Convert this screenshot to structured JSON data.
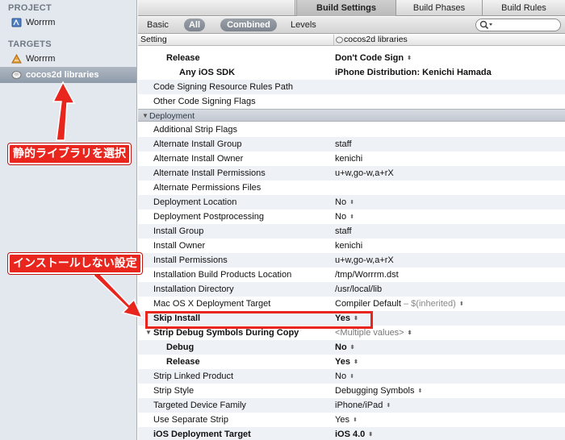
{
  "navigator": {
    "project_header": "PROJECT",
    "project_item": "Worrrm",
    "targets_header": "TARGETS",
    "targets": [
      {
        "label": "Worrrm",
        "selected": false
      },
      {
        "label": "cocos2d libraries",
        "selected": true
      }
    ]
  },
  "tabs": [
    "Build Settings",
    "Build Phases",
    "Build Rules"
  ],
  "active_tab": "Build Settings",
  "filters": {
    "basic": "Basic",
    "all": "All",
    "combined": "Combined",
    "levels": "Levels",
    "search_placeholder": ""
  },
  "columns": {
    "setting": "Setting",
    "target": "cocos2d libraries"
  },
  "rows": {
    "r0": {
      "name": "Release",
      "value": "Don't Code Sign"
    },
    "r1": {
      "name": "Any iOS SDK",
      "value": "iPhone Distribution: Kenichi Hamada"
    },
    "r2": {
      "name": "Code Signing Resource Rules Path",
      "value": ""
    },
    "r3": {
      "name": "Other Code Signing Flags",
      "value": ""
    },
    "section_deployment": "Deployment",
    "r4": {
      "name": "Additional Strip Flags",
      "value": ""
    },
    "r5": {
      "name": "Alternate Install Group",
      "value": "staff"
    },
    "r6": {
      "name": "Alternate Install Owner",
      "value": "kenichi"
    },
    "r7": {
      "name": "Alternate Install Permissions",
      "value": "u+w,go-w,a+rX"
    },
    "r8": {
      "name": "Alternate Permissions Files",
      "value": ""
    },
    "r9": {
      "name": "Deployment Location",
      "value": "No"
    },
    "r10": {
      "name": "Deployment Postprocessing",
      "value": "No"
    },
    "r11": {
      "name": "Install Group",
      "value": "staff"
    },
    "r12": {
      "name": "Install Owner",
      "value": "kenichi"
    },
    "r13": {
      "name": "Install Permissions",
      "value": "u+w,go-w,a+rX"
    },
    "r14": {
      "name": "Installation Build Products Location",
      "value": "/tmp/Worrrm.dst"
    },
    "r15": {
      "name": "Installation Directory",
      "value": "/usr/local/lib"
    },
    "r16": {
      "name": "Mac OS X Deployment Target",
      "value": "Compiler Default",
      "inherited": "–  $(inherited)"
    },
    "r17": {
      "name": "Skip Install",
      "value": "Yes"
    },
    "r18": {
      "name": "Strip Debug Symbols During Copy",
      "value": "<Multiple values>"
    },
    "r19": {
      "name": "Debug",
      "value": "No"
    },
    "r20": {
      "name": "Release",
      "value": "Yes"
    },
    "r21": {
      "name": "Strip Linked Product",
      "value": "No"
    },
    "r22": {
      "name": "Strip Style",
      "value": "Debugging Symbols"
    },
    "r23": {
      "name": "Targeted Device Family",
      "value": "iPhone/iPad"
    },
    "r24": {
      "name": "Use Separate Strip",
      "value": "Yes"
    },
    "r25": {
      "name": "iOS Deployment Target",
      "value": "iOS 4.0"
    }
  },
  "annotations": {
    "select_static_library": "静的ライブラリを選択",
    "no_install_setting": "インストールしない設定"
  },
  "colors": {
    "annotation_red": "#e8261e",
    "selection": "#8f9baa"
  }
}
